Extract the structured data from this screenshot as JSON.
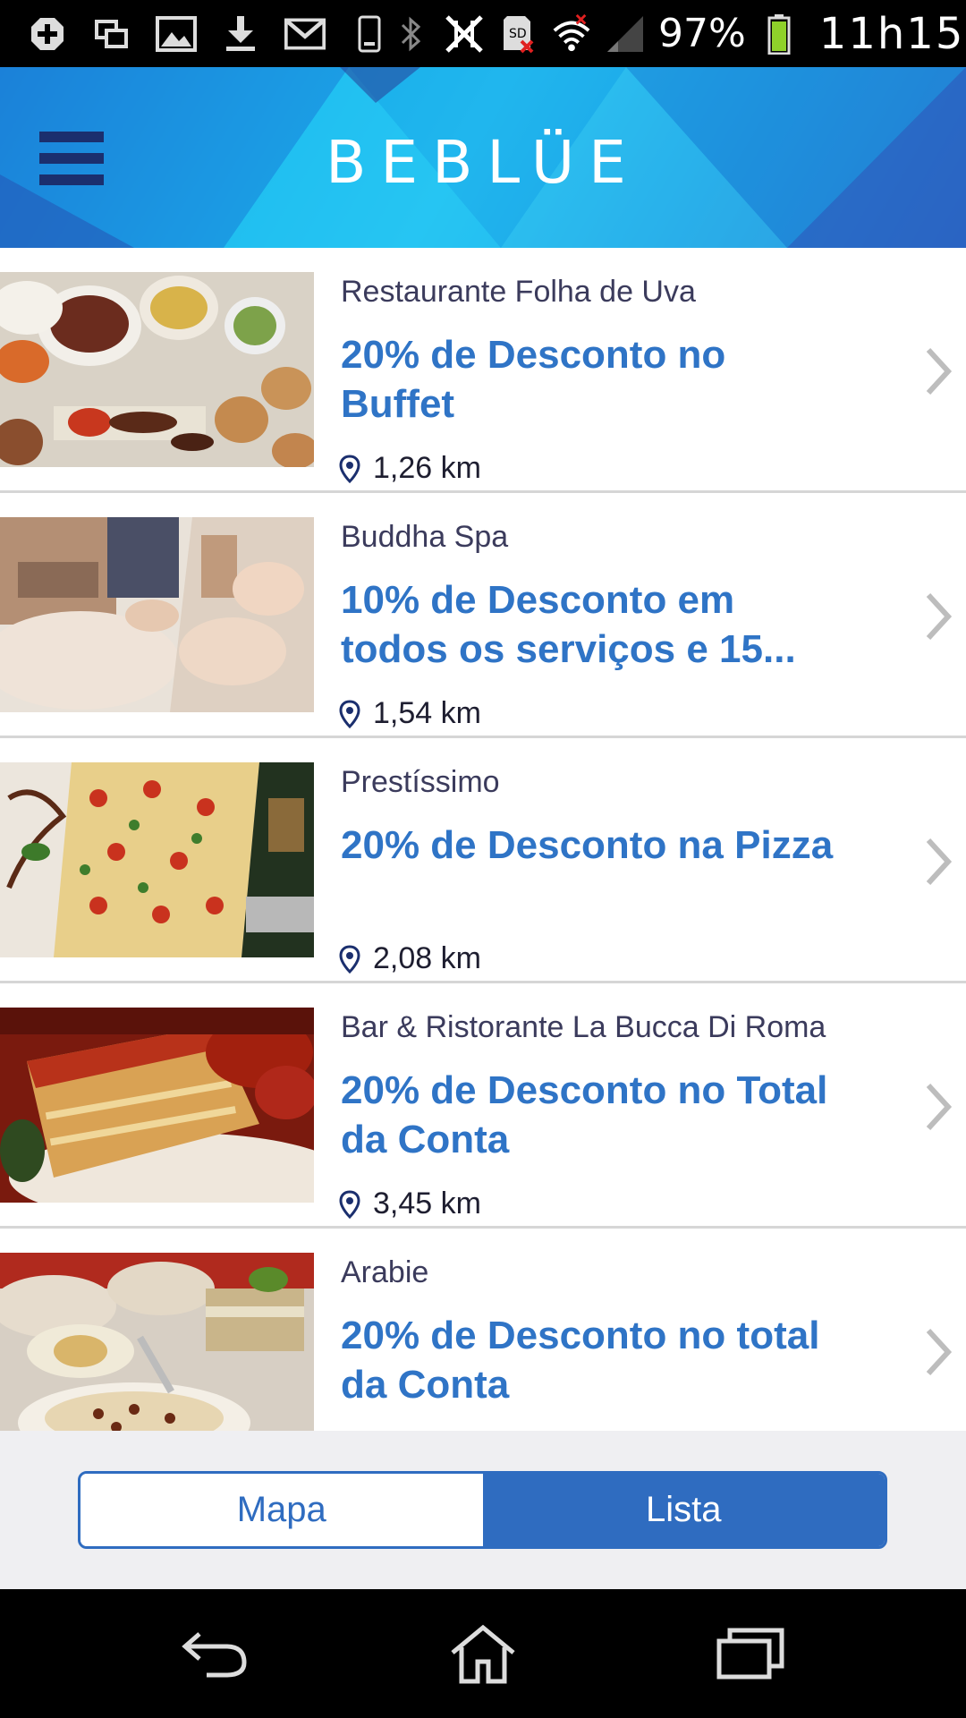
{
  "status_bar": {
    "battery_text": "97%",
    "time": "11h15",
    "icons_left": [
      "add-icon",
      "screens-icon",
      "image-icon",
      "download-icon",
      "gmail-icon",
      "phone-icon"
    ],
    "icons_right": [
      "bluetooth-icon",
      "nfc-off-icon",
      "sd-card-error-icon",
      "wifi-icon",
      "signal-icon",
      "battery-icon"
    ]
  },
  "header": {
    "brand": "BEBLÜE",
    "menu_icon": "hamburger-menu-icon"
  },
  "offers": [
    {
      "vendor": "Restaurante Folha de Uva",
      "title": "20% de Desconto no Buffet",
      "distance": "1,26 km",
      "image": "food-platter-photo"
    },
    {
      "vendor": "Buddha Spa",
      "title": "10% de Desconto em todos os serviços e 15...",
      "distance": "1,54 km",
      "image": "spa-massage-photo"
    },
    {
      "vendor": "Prestíssimo",
      "title": "20% de Desconto na Pizza",
      "distance": "2,08 km",
      "image": "pizza-photo"
    },
    {
      "vendor": "Bar & Ristorante La Bucca Di Roma",
      "title": "20% de Desconto no Total da Conta",
      "distance": "3,45 km",
      "image": "lasagna-photo"
    },
    {
      "vendor": "Arabie",
      "title": "20% de Desconto no total da Conta",
      "distance": "",
      "image": "arabic-food-photo"
    }
  ],
  "toggle": {
    "map_label": "Mapa",
    "list_label": "Lista",
    "selected": "Lista"
  },
  "nav": {
    "icons": [
      "back-icon",
      "home-icon",
      "recent-apps-icon"
    ]
  },
  "colors": {
    "accent": "#2f6cc0",
    "title_blue": "#2f74c6",
    "header_blue": "#19b4ec",
    "menu_navy": "#1b2f6e"
  }
}
